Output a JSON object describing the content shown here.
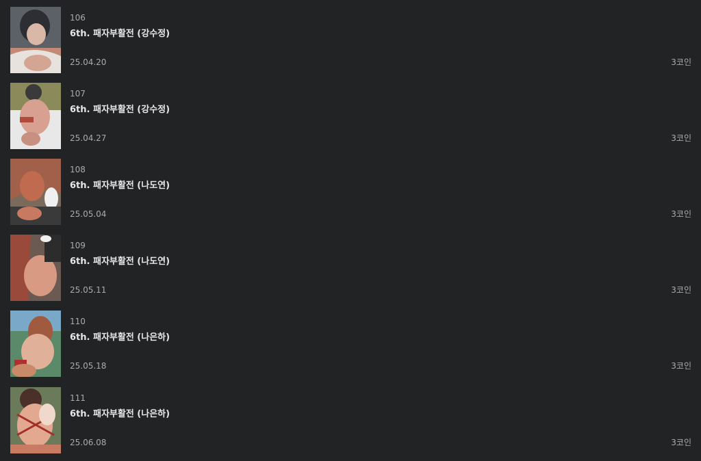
{
  "episodes": [
    {
      "number": "106",
      "title": "6th. 패자부활전 (강수정)",
      "date": "25.04.20",
      "price": "3코인"
    },
    {
      "number": "107",
      "title": "6th. 패자부활전 (강수정)",
      "date": "25.04.27",
      "price": "3코인"
    },
    {
      "number": "108",
      "title": "6th. 패자부활전 (나도연)",
      "date": "25.05.04",
      "price": "3코인"
    },
    {
      "number": "109",
      "title": "6th. 패자부활전 (나도연)",
      "date": "25.05.11",
      "price": "3코인"
    },
    {
      "number": "110",
      "title": "6th. 패자부활전 (나은하)",
      "date": "25.05.18",
      "price": "3코인"
    },
    {
      "number": "111",
      "title": "6th. 패자부활전 (나은하)",
      "date": "25.06.08",
      "price": "3코인"
    }
  ],
  "thumbnail_palettes": [
    [
      "#5c6168",
      "#d9b8a8",
      "#2c2e33",
      "#c48a78"
    ],
    [
      "#8a8a5a",
      "#e8e8e8",
      "#b04a3a",
      "#d8a090"
    ],
    [
      "#7a6a5c",
      "#c06a50",
      "#f0f0f0",
      "#3a3a3a"
    ],
    [
      "#6a5a52",
      "#9a4a3a",
      "#d89a82",
      "#2c2c2c"
    ],
    [
      "#5a8a6a",
      "#c98a6a",
      "#e0b098",
      "#b03030"
    ],
    [
      "#6a7a5a",
      "#c87a62",
      "#e2a890",
      "#a03028"
    ]
  ]
}
